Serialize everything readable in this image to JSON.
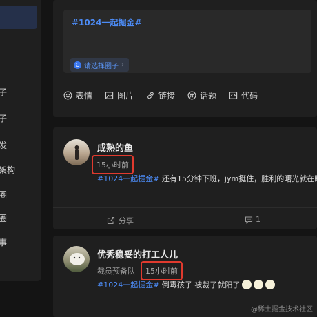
{
  "sidebar": {
    "items": [
      {
        "label": "子"
      },
      {
        "label": "子"
      },
      {
        "label": "发"
      },
      {
        "label": "架构"
      },
      {
        "label": "圈"
      },
      {
        "label": "圈"
      },
      {
        "label": "事"
      }
    ]
  },
  "editor": {
    "topic_text": "#1024一起掘金#",
    "circle_selector_label": "请选择圈子",
    "circle_icon_letter": "C",
    "toolbar": {
      "emoji_label": "表情",
      "image_label": "图片",
      "link_label": "链接",
      "topic_label": "话题",
      "code_label": "代码"
    }
  },
  "posts": [
    {
      "author": "成熟的鱼",
      "badge": "",
      "time": "15小时前",
      "topic": "#1024一起掘金#",
      "text": " 还有15分钟下班，jym挺住，胜利的曙光就在眼",
      "share_label": "分享",
      "comment_count": "1"
    },
    {
      "author": "优秀稳妥的打工人儿",
      "badge": "裁员预备队",
      "time": "15小时前",
      "topic": "#1024一起掘金#",
      "text": " 倒霉孩子 被裁了就阳了"
    }
  ],
  "watermark": "@稀土掘金技术社区",
  "colors": {
    "accent": "#4c8bf5",
    "highlight": "#e03a2e",
    "card": "#1f1f1f",
    "background": "#141414"
  }
}
